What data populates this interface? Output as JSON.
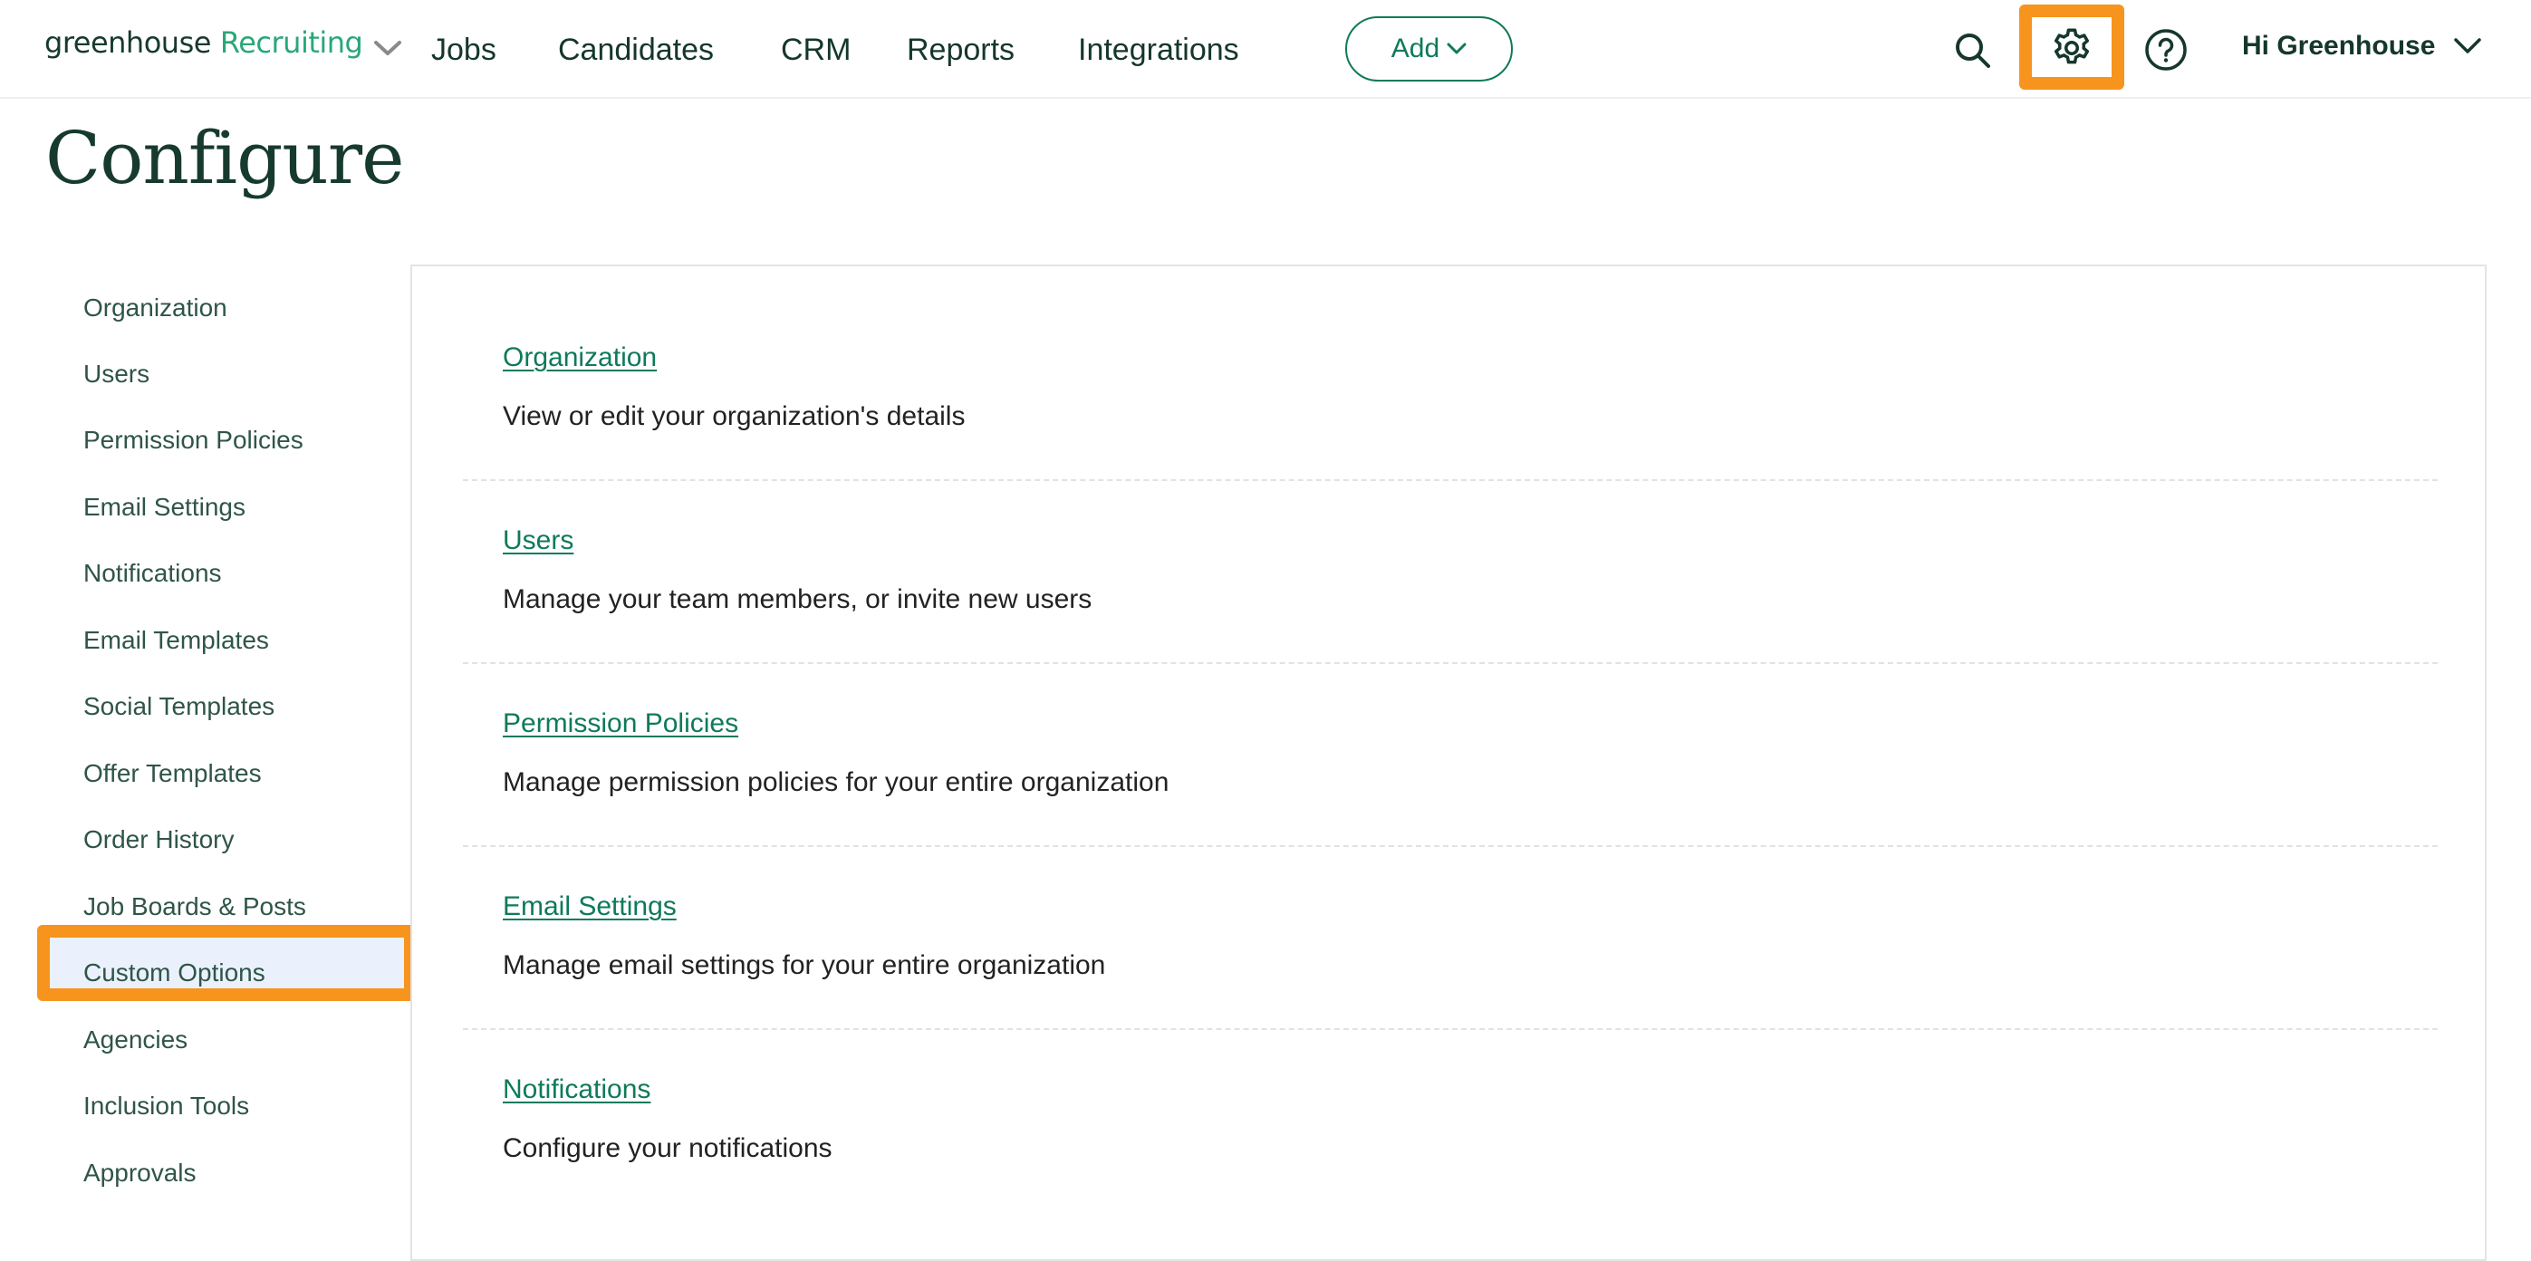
{
  "header": {
    "logo_word": "greenhouse",
    "logo_product": "Recruiting",
    "nav": [
      "Jobs",
      "Candidates",
      "CRM",
      "Reports",
      "Integrations"
    ],
    "add_label": "Add",
    "icons": {
      "search": "search-icon",
      "settings": "gear-icon",
      "help": "help-icon",
      "user_menu_chevron": "chevron-down-icon"
    },
    "user_greeting": "Hi Greenhouse",
    "highlighted_icon": "settings"
  },
  "page": {
    "title": "Configure"
  },
  "sidebar": {
    "items": [
      {
        "label": "Organization"
      },
      {
        "label": "Users"
      },
      {
        "label": "Permission Policies"
      },
      {
        "label": "Email Settings"
      },
      {
        "label": "Notifications"
      },
      {
        "label": "Email Templates"
      },
      {
        "label": "Social Templates"
      },
      {
        "label": "Offer Templates"
      },
      {
        "label": "Order History"
      },
      {
        "label": "Job Boards & Posts"
      },
      {
        "label": "Custom Options",
        "highlighted": true
      },
      {
        "label": "Agencies"
      },
      {
        "label": "Inclusion Tools"
      },
      {
        "label": "Approvals"
      }
    ]
  },
  "sections": [
    {
      "title": "Organization",
      "description": "View or edit your organization's details"
    },
    {
      "title": "Users",
      "description": "Manage your team members, or invite new users"
    },
    {
      "title": "Permission Policies",
      "description": "Manage permission policies for your entire organization"
    },
    {
      "title": "Email Settings",
      "description": "Manage email settings for your entire organization"
    },
    {
      "title": "Notifications",
      "description": "Configure your notifications"
    }
  ],
  "colors": {
    "brand_dark": "#15372c",
    "brand_green": "#2aa77a",
    "link_green": "#0e7a5a",
    "highlight_orange": "#f7941d",
    "selected_bg": "#eaf1fd"
  }
}
